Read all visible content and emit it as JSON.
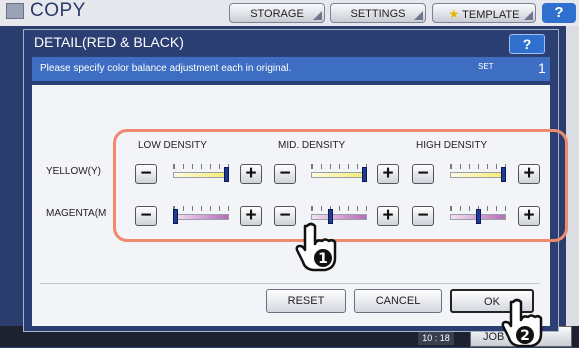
{
  "app": {
    "title": "COPY",
    "tabs": [
      {
        "label": "STORAGE"
      },
      {
        "label": "SETTINGS"
      },
      {
        "label": "TEMPLATE"
      }
    ],
    "help_label": "?"
  },
  "dialog": {
    "title": "DETAIL(RED & BLACK)",
    "help_label": "?",
    "message": "Please specify color balance adjustment each in original.",
    "set_label": "SET",
    "set_number": "1",
    "columns": [
      "LOW DENSITY",
      "MID. DENSITY",
      "HIGH DENSITY"
    ],
    "rows": [
      {
        "label": "YELLOW(Y)",
        "levels": [
          7,
          7,
          7
        ]
      },
      {
        "label": "MAGENTA(M",
        "levels": [
          1,
          3,
          4
        ]
      }
    ],
    "slider_steps": 7,
    "minus_label": "−",
    "plus_label": "+",
    "buttons": {
      "reset": "RESET",
      "cancel": "CANCEL",
      "ok": "OK"
    }
  },
  "status": {
    "clock": "10 : 18",
    "job_label": "JOB"
  },
  "callouts": [
    "1",
    "2"
  ],
  "colors": {
    "accent_blue": "#3d6ec2",
    "highlight": "#ef8a6f",
    "knob": "#1f3b93"
  }
}
